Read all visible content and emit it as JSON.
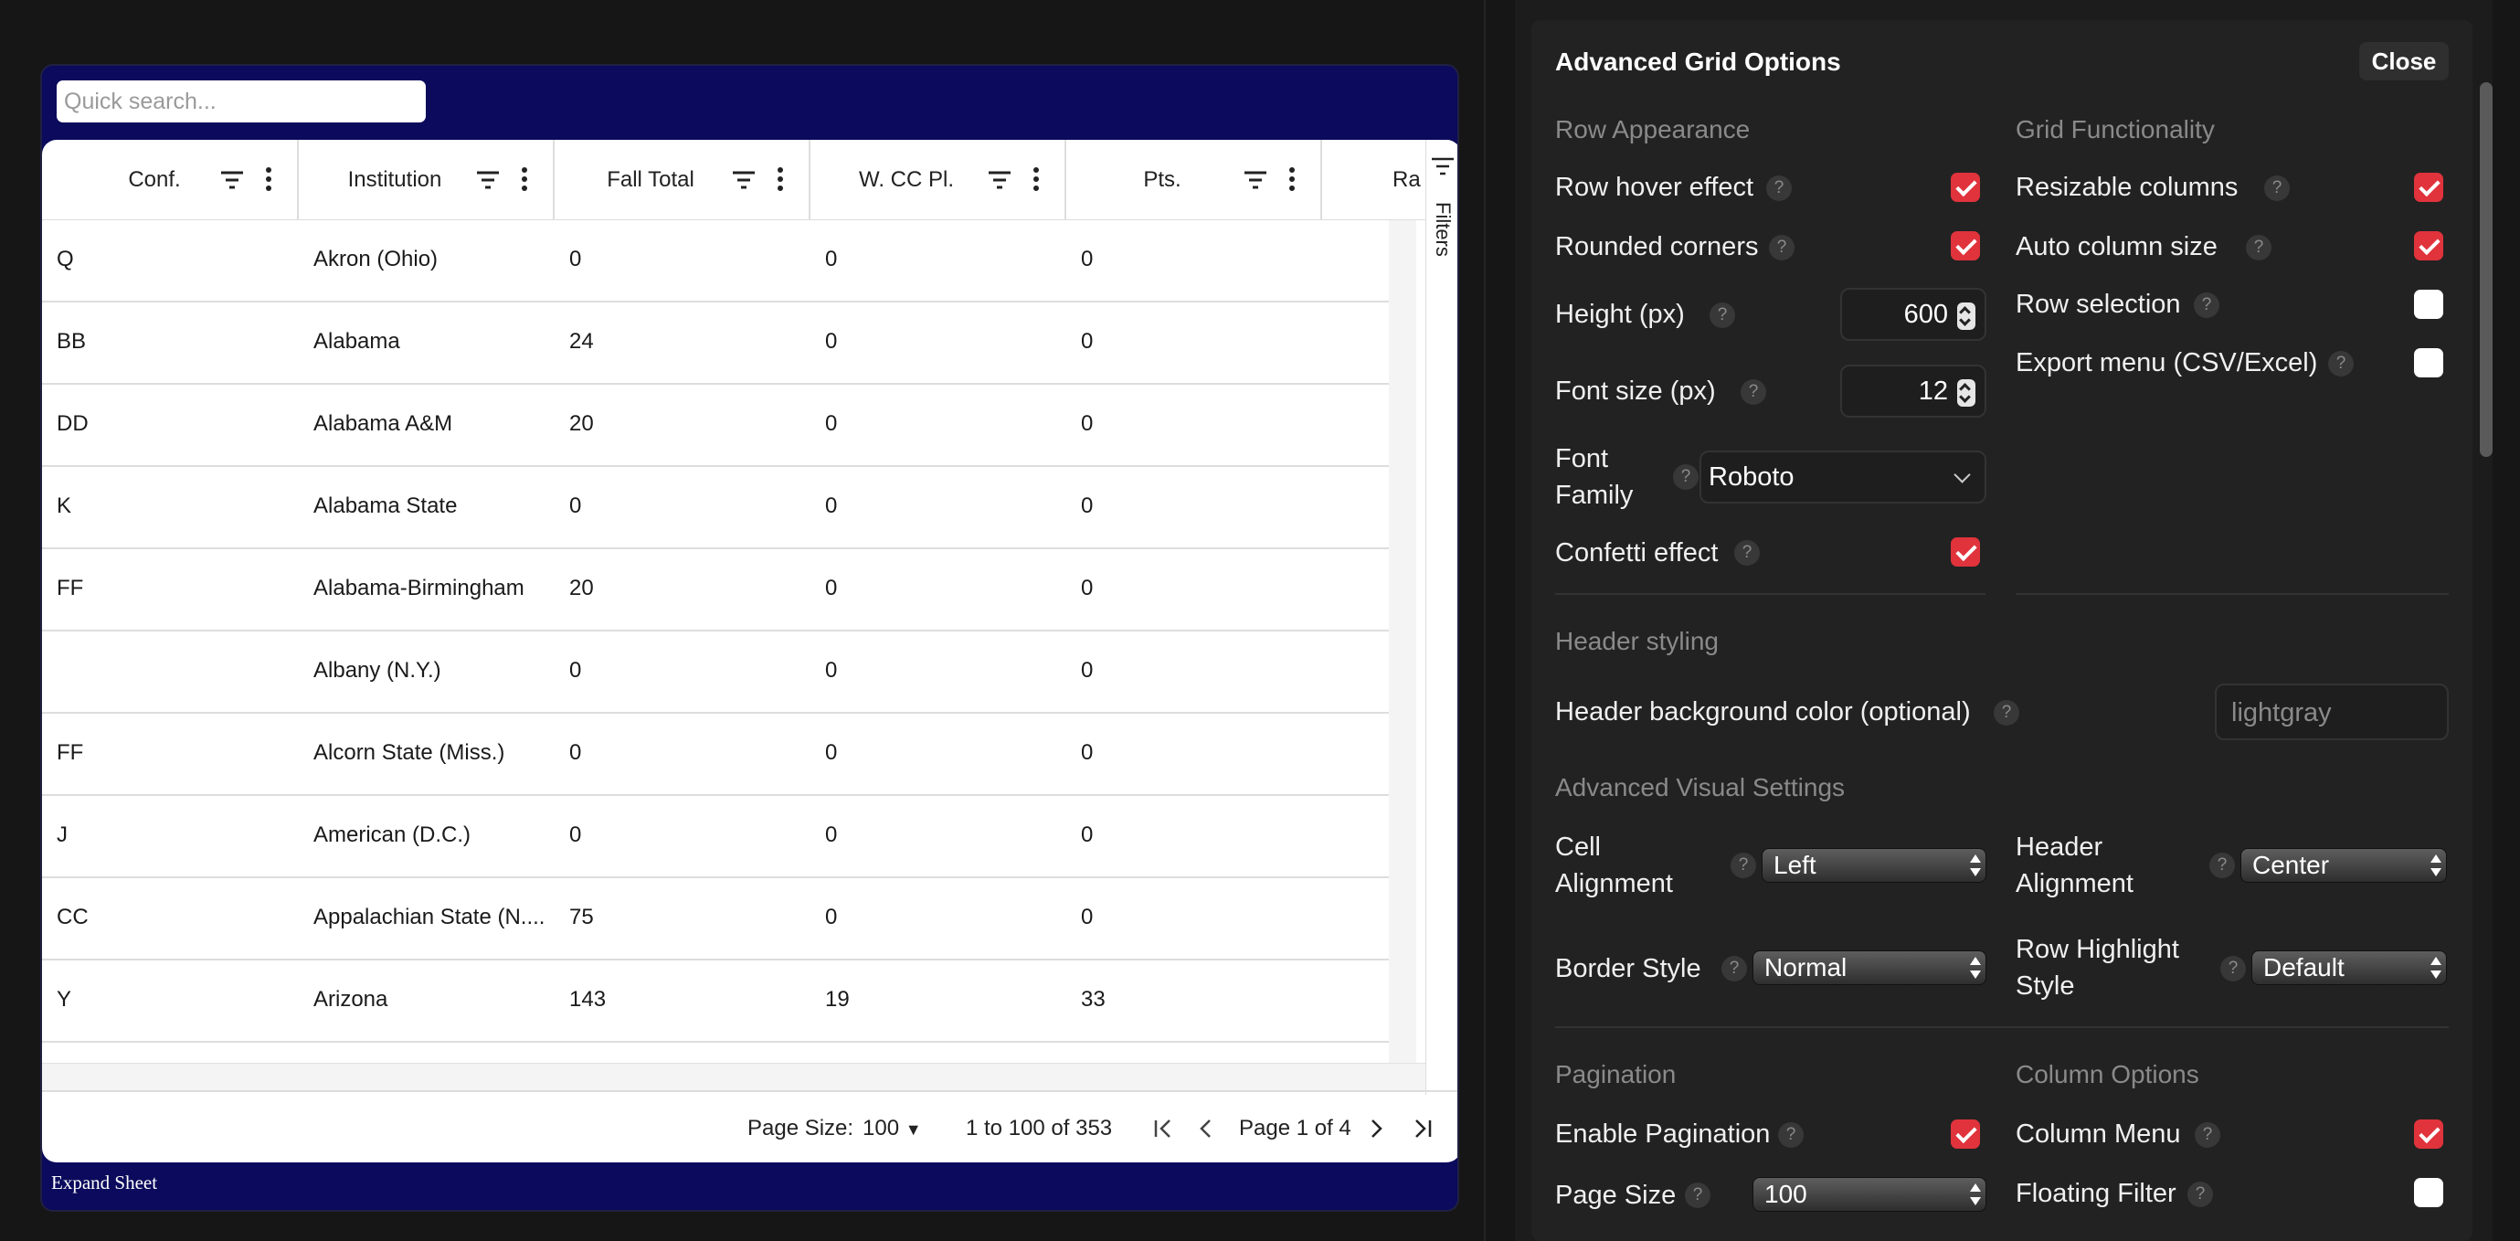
{
  "grid": {
    "search_placeholder": "Quick search...",
    "columns": [
      {
        "label": "Conf."
      },
      {
        "label": "Institution"
      },
      {
        "label": "Fall Total"
      },
      {
        "label": "W. CC Pl."
      },
      {
        "label": "Pts."
      },
      {
        "label": "Ra"
      }
    ],
    "filters_label": "Filters",
    "rows": [
      [
        "Q",
        "Akron (Ohio)",
        "0",
        "0",
        "0"
      ],
      [
        "BB",
        "Alabama",
        "24",
        "0",
        "0"
      ],
      [
        "DD",
        "Alabama A&M",
        "20",
        "0",
        "0"
      ],
      [
        "K",
        "Alabama State",
        "0",
        "0",
        "0"
      ],
      [
        "FF",
        "Alabama-Birmingham",
        "20",
        "0",
        "0"
      ],
      [
        "",
        "Albany (N.Y.)",
        "0",
        "0",
        "0"
      ],
      [
        "FF",
        "Alcorn State (Miss.)",
        "0",
        "0",
        "0"
      ],
      [
        "J",
        "American (D.C.)",
        "0",
        "0",
        "0"
      ],
      [
        "CC",
        "Appalachian State (N....",
        "75",
        "0",
        "0"
      ],
      [
        "Y",
        "Arizona",
        "143",
        "19",
        "33"
      ]
    ],
    "footer": {
      "page_size_label": "Page Size:",
      "page_size_value": "100",
      "range": "1 to 100 of 353",
      "page_info": "Page 1 of 4"
    },
    "expand_label": "Expand Sheet"
  },
  "panel": {
    "title": "Advanced Grid Options",
    "close": "Close",
    "row_appearance": {
      "title": "Row Appearance",
      "row_hover": "Row hover effect",
      "row_hover_checked": true,
      "rounded": "Rounded corners",
      "rounded_checked": true,
      "height_label": "Height (px)",
      "height_value": "600",
      "font_size_label": "Font size (px)",
      "font_size_value": "12",
      "font_family_label_1": "Font",
      "font_family_label_2": "Family",
      "font_family_value": "Roboto",
      "confetti": "Confetti effect",
      "confetti_checked": true
    },
    "grid_functionality": {
      "title": "Grid Functionality",
      "resizable": "Resizable columns",
      "resizable_checked": true,
      "auto_size": "Auto column size",
      "auto_size_checked": true,
      "row_selection": "Row selection",
      "row_selection_checked": false,
      "export_menu": "Export menu (CSV/Excel)",
      "export_menu_checked": false
    },
    "header_styling": {
      "title": "Header styling",
      "bg_label": "Header background color (optional)",
      "bg_placeholder": "lightgray"
    },
    "advanced_visual": {
      "title": "Advanced Visual Settings",
      "cell_align_1": "Cell",
      "cell_align_2": "Alignment",
      "cell_align_value": "Left",
      "header_align_1": "Header",
      "header_align_2": "Alignment",
      "header_align_value": "Center",
      "border_style": "Border Style",
      "border_style_value": "Normal",
      "row_highlight_1": "Row Highlight",
      "row_highlight_2": "Style",
      "row_highlight_value": "Default"
    },
    "pagination": {
      "title": "Pagination",
      "enable": "Enable Pagination",
      "enable_checked": true,
      "page_size": "Page Size",
      "page_size_value": "100"
    },
    "column_options": {
      "title": "Column Options",
      "column_menu": "Column Menu",
      "column_menu_checked": true,
      "floating_filter": "Floating Filter",
      "floating_filter_checked": false
    },
    "help_icon_glyph": "?"
  }
}
